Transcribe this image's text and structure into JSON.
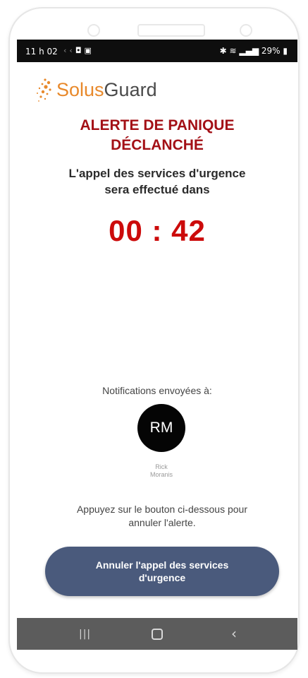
{
  "status": {
    "time": "11 h 02",
    "battery": "29%"
  },
  "logo": {
    "brand_primary": "Solus",
    "brand_secondary": "Guard",
    "primary_color": "#e8892b"
  },
  "alert": {
    "title_line1": "ALERTE DE PANIQUE",
    "title_line2": "DÉCLANCHÉ",
    "subtitle_line1": "L'appel des services d'urgence",
    "subtitle_line2": "sera effectué dans",
    "countdown": "00 : 42"
  },
  "notifications": {
    "label": "Notifications envoyées à:",
    "contacts": [
      {
        "initials": "RM",
        "first_name": "Rick",
        "last_name": "Moranis"
      }
    ]
  },
  "instruction": {
    "line1": "Appuyez sur le bouton ci-dessous pour",
    "line2": "annuler l'alerte."
  },
  "cancel_button": {
    "label": "Annuler l'appel des services d'urgence"
  },
  "navbar": {
    "recent_icon": "recent-apps-icon",
    "home_icon": "home-icon",
    "back_icon": "back-icon"
  },
  "colors": {
    "alert_red": "#a31016",
    "countdown_red": "#cc0b0b",
    "button_blue": "#4a5a7c"
  }
}
